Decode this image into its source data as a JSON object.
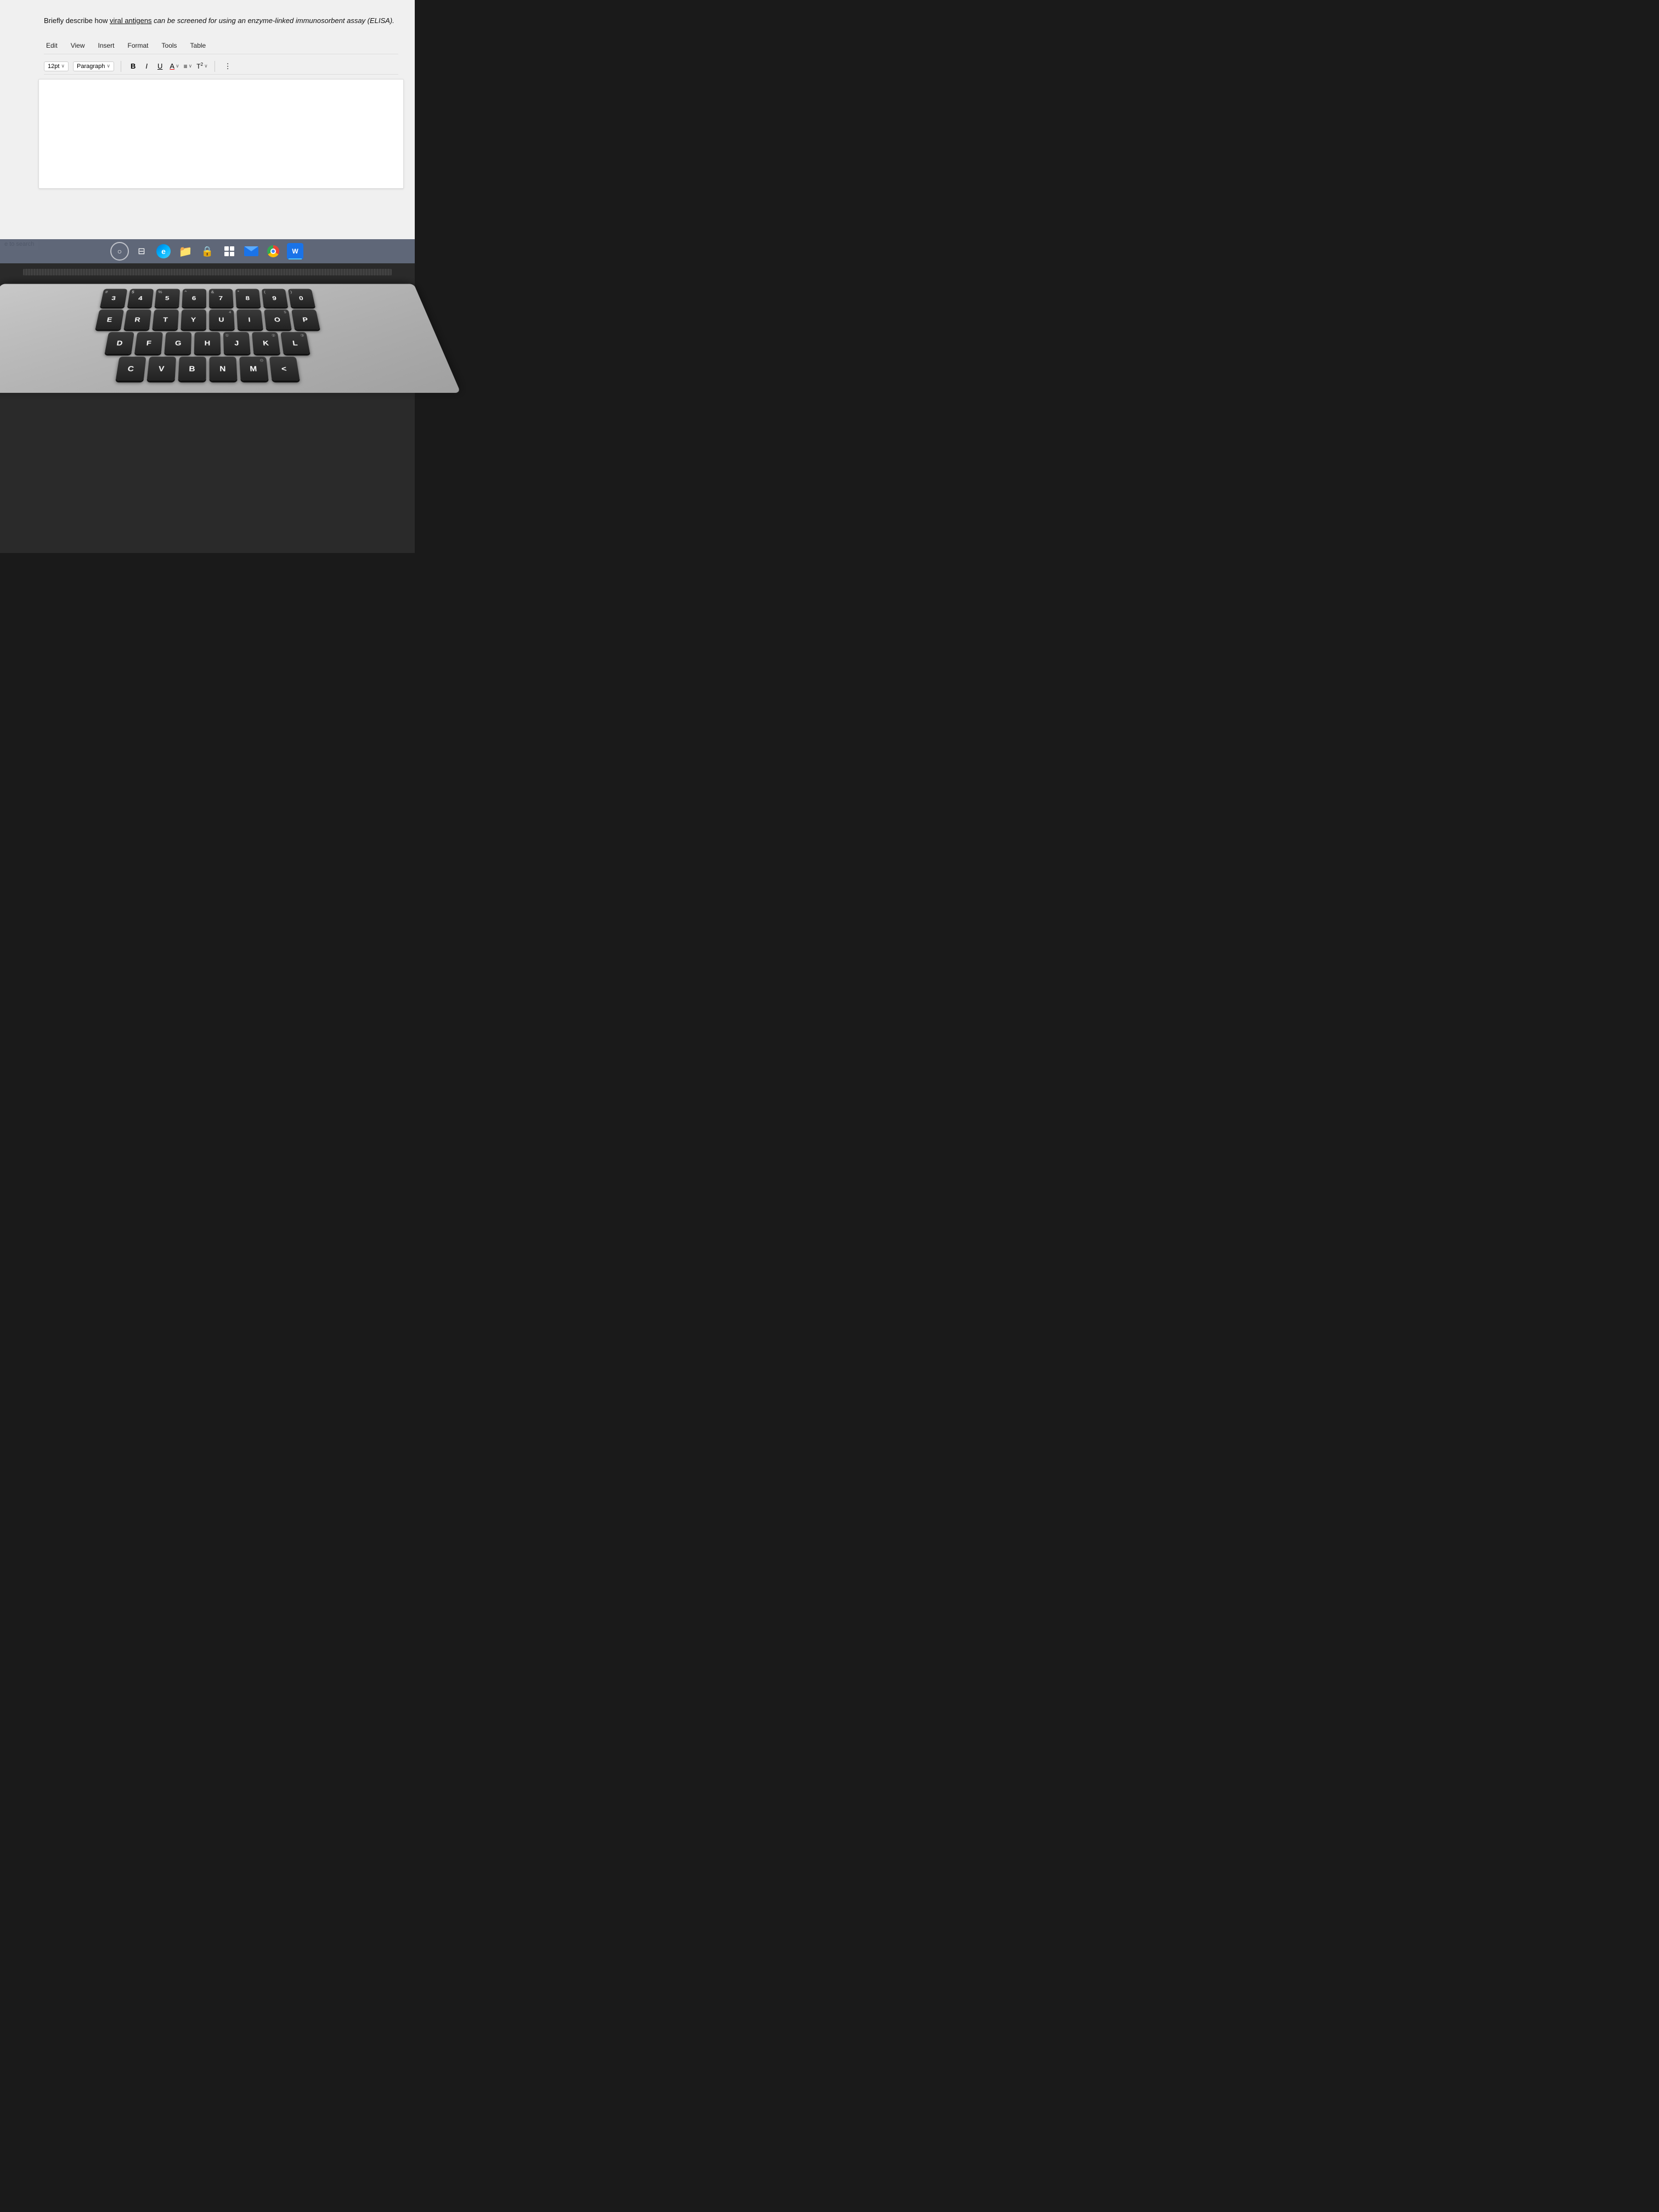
{
  "document": {
    "question_part1": "Briefly describe how ",
    "question_link": "viral antigens",
    "question_part2": " can be screened for using an enzyme-linked immunosorbent assay (ELISA)."
  },
  "menu": {
    "items": [
      "Edit",
      "View",
      "Insert",
      "Format",
      "Tools",
      "Table"
    ]
  },
  "toolbar": {
    "font_size": "12pt",
    "font_size_chevron": "∨",
    "paragraph": "Paragraph",
    "paragraph_chevron": "∨",
    "bold": "B",
    "italic": "I",
    "underline": "U",
    "font_color": "A",
    "more_options": "⋮"
  },
  "taskbar": {
    "search_placeholder": "e to search",
    "icons": [
      {
        "name": "search-circle",
        "label": "○"
      },
      {
        "name": "task-view",
        "label": "⊞"
      },
      {
        "name": "chrome-edge",
        "label": "edge"
      },
      {
        "name": "folder",
        "label": "📁"
      },
      {
        "name": "lock",
        "label": "🔒"
      },
      {
        "name": "windows-grid",
        "label": "⊞"
      },
      {
        "name": "email",
        "label": "✉"
      },
      {
        "name": "chrome",
        "label": "chrome"
      },
      {
        "name": "word",
        "label": "W"
      }
    ]
  },
  "keyboard": {
    "rows": [
      [
        "#3",
        "$4",
        "%5",
        "^6",
        "&7",
        "•8",
        "9",
        "0"
      ],
      [
        "E",
        "R",
        "T",
        "Y",
        "U",
        "I",
        "O",
        "P"
      ],
      [
        "D",
        "F",
        "G",
        "H",
        "J",
        "K",
        "L"
      ],
      [
        "C",
        "V",
        "B",
        "N",
        "M",
        "<"
      ]
    ]
  }
}
